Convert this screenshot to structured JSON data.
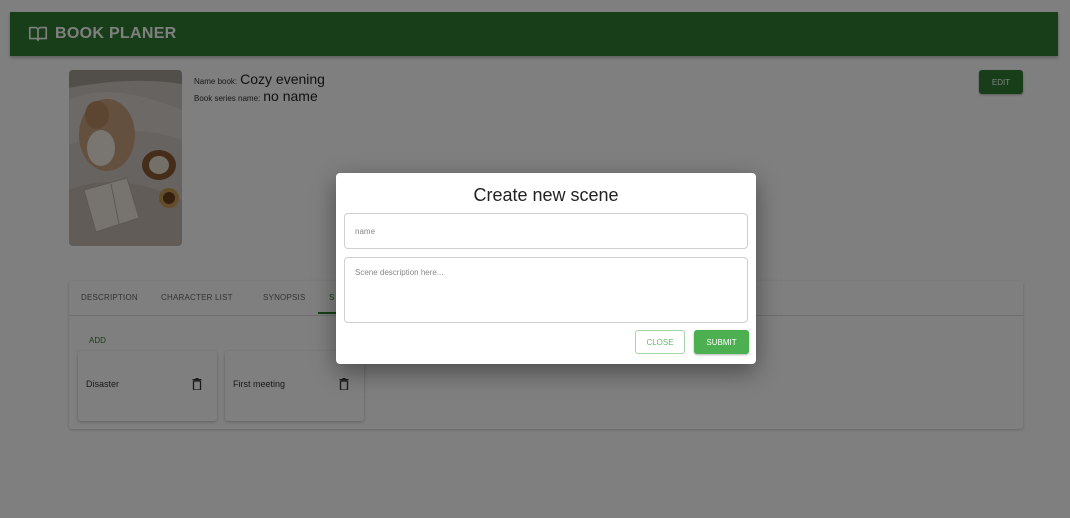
{
  "app": {
    "title": "BOOK PLANER",
    "brand_color": "#2e7d32",
    "logo_icon": "open-book-icon"
  },
  "book": {
    "name_label": "Name book:",
    "name_value": "Cozy evening",
    "series_label": "Book series name:",
    "series_value": "no name",
    "cover_alt": "book-cover-image"
  },
  "toolbar": {
    "edit_label": "EDIT"
  },
  "tabs": [
    {
      "label": "DESCRIPTION",
      "active": false
    },
    {
      "label": "CHARACTER LIST",
      "active": false
    },
    {
      "label": "SYNOPSIS",
      "active": false
    },
    {
      "label": "S",
      "active": true
    }
  ],
  "scenes": {
    "add_label": "ADD",
    "items": [
      {
        "name": "Disaster",
        "delete_icon": "trash-icon"
      },
      {
        "name": "First meeting",
        "delete_icon": "trash-icon"
      }
    ]
  },
  "dialog": {
    "title": "Create new scene",
    "name_placeholder": "name",
    "description_placeholder": "Scene description here...",
    "close_label": "CLOSE",
    "submit_label": "SUBMIT"
  }
}
